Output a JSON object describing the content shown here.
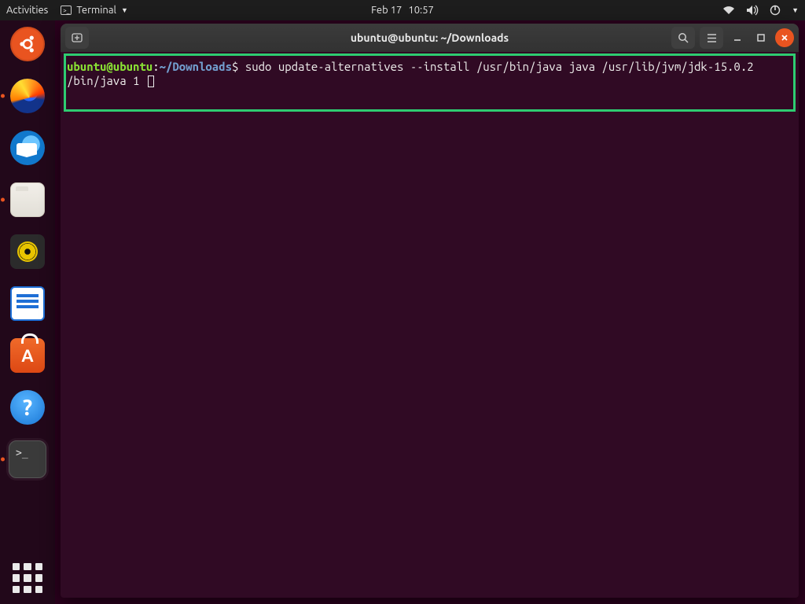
{
  "topbar": {
    "activities": "Activities",
    "app_name": "Terminal",
    "date": "Feb 17",
    "time": "10:57"
  },
  "window": {
    "title": "ubuntu@ubuntu: ~/Downloads",
    "newtab_tooltip": "New Tab"
  },
  "terminal": {
    "user_host": "ubuntu@ubuntu",
    "sep": ":",
    "cwd": "~/Downloads",
    "prompt_suffix": "$ ",
    "command_line1": "sudo update-alternatives --install /usr/bin/java java /usr/lib/jvm/jdk-15.0.2",
    "command_line2": "/bin/java 1 "
  },
  "dock": {
    "store_glyph": "A",
    "help_glyph": "?",
    "term_glyph": ">_"
  }
}
